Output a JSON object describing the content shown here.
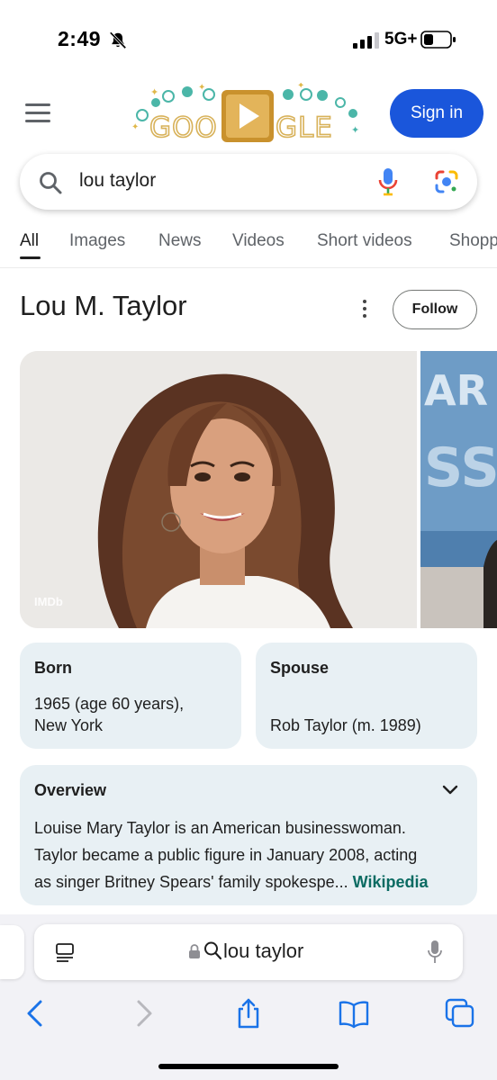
{
  "status_bar": {
    "time": "2:49",
    "network": "5G+",
    "icons": [
      "bell-slash-icon",
      "signal-icon",
      "battery-icon"
    ]
  },
  "header": {
    "menu_icon": "hamburger-icon",
    "logo": "GOO GLE",
    "sign_in_label": "Sign in"
  },
  "search": {
    "query": "lou taylor",
    "icons": [
      "search-icon",
      "mic-icon",
      "lens-icon"
    ]
  },
  "tabs": [
    {
      "label": "All",
      "active": true
    },
    {
      "label": "Images",
      "active": false
    },
    {
      "label": "News",
      "active": false
    },
    {
      "label": "Videos",
      "active": false
    },
    {
      "label": "Short videos",
      "active": false
    },
    {
      "label": "Shopp",
      "active": false
    }
  ],
  "knowledge_panel": {
    "title": "Lou M. Taylor",
    "follow_label": "Follow",
    "photo_source": "IMDb",
    "facts": [
      {
        "label": "Born",
        "value_line1": "1965 (age 60 years),",
        "value_line2": "New York"
      },
      {
        "label": "Spouse",
        "value_line1": "Rob Taylor (m. 1989)"
      }
    ],
    "overview": {
      "label": "Overview",
      "line1": "Louise Mary Taylor is an American businesswoman.",
      "line2": "Taylor became a public figure in January 2008, acting",
      "line3": "as singer Britney Spears' family spokespe",
      "ellipsis": "...",
      "source_link": "Wikipedia"
    }
  },
  "safari": {
    "address_text": "lou taylor",
    "icons": [
      "reader-icon",
      "lock-icon",
      "search-icon",
      "mic-icon",
      "back-icon",
      "forward-icon",
      "share-icon",
      "bookmarks-icon",
      "tabs-icon"
    ]
  },
  "colors": {
    "sign_in_bg": "#1a56db",
    "card_bg": "#e8f0f4",
    "link": "#0b6b62",
    "safari_accent": "#1a73e8"
  }
}
